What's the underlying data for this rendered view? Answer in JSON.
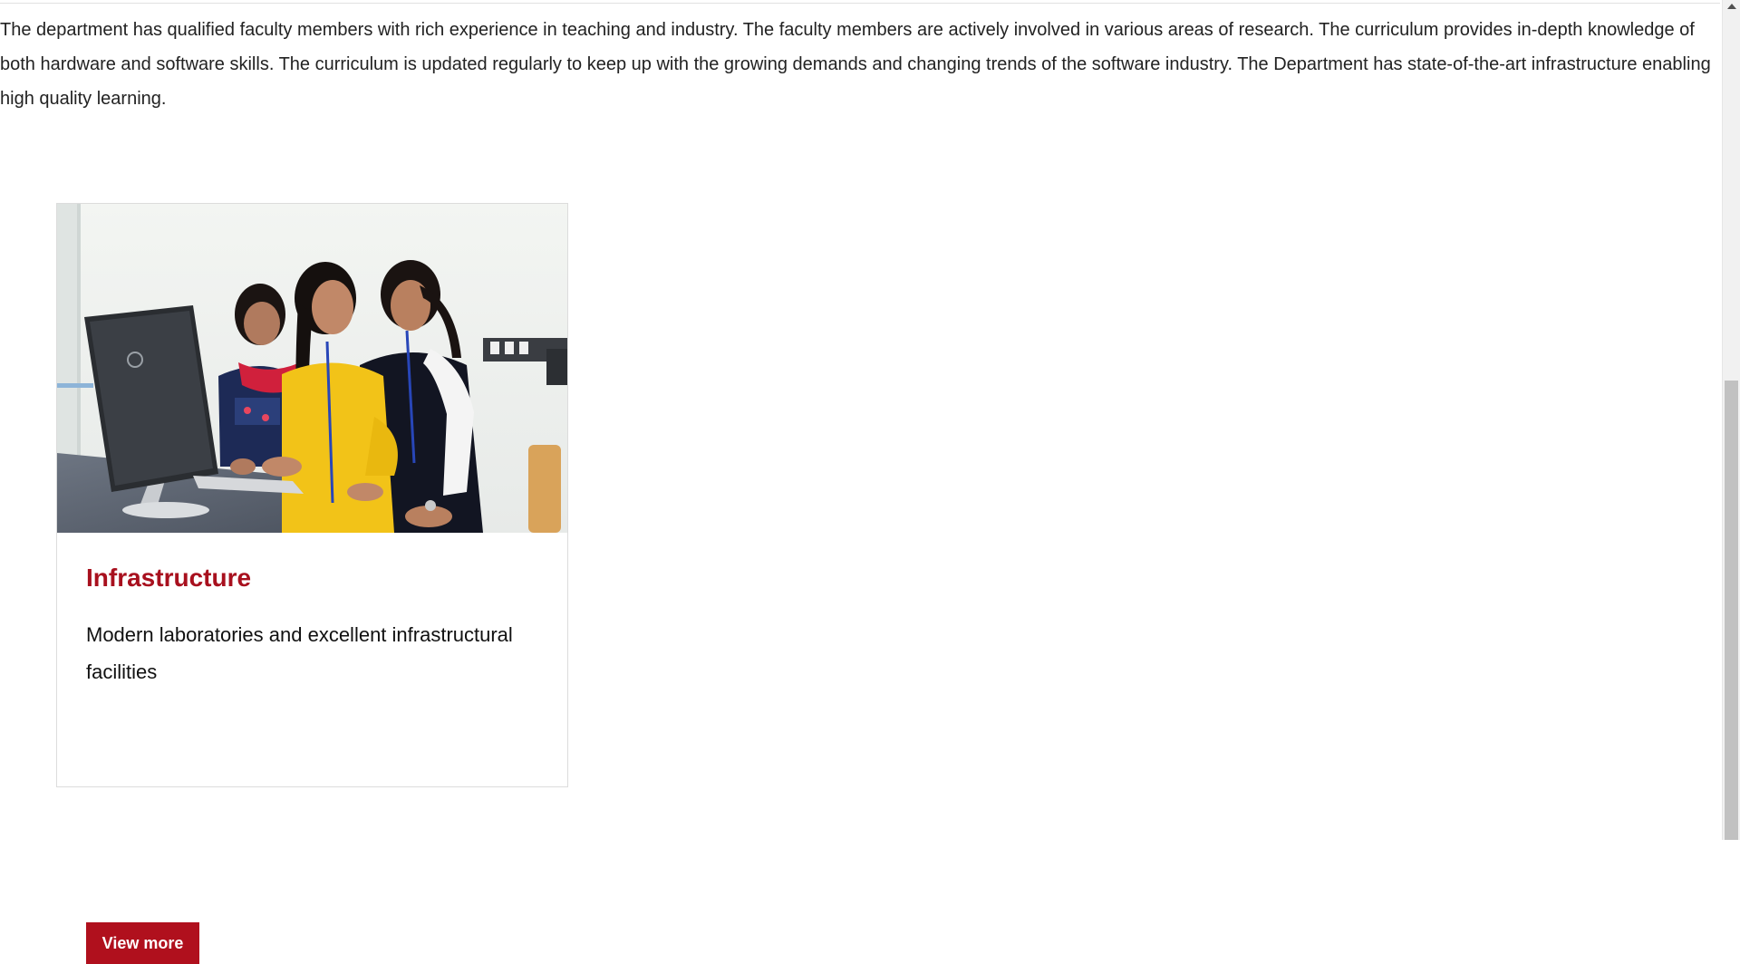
{
  "intro": {
    "text": "The department has qualified faculty members with rich experience in teaching and industry. The faculty members are actively involved in various areas of research. The curriculum provides in-depth knowledge of both hardware and software skills. The curriculum is updated regularly to keep up with the growing demands and changing trends of the software industry. The Department has state-of-the-art infrastructure enabling high quality learning."
  },
  "card": {
    "title": "Infrastructure",
    "description": "Modern laboratories and excellent infrastructural facilities",
    "button_label": "View more",
    "image_subject": "three students at an HP all-in-one computer in a lab",
    "accent_color": "#a8101e",
    "button_color": "#b0101d"
  }
}
